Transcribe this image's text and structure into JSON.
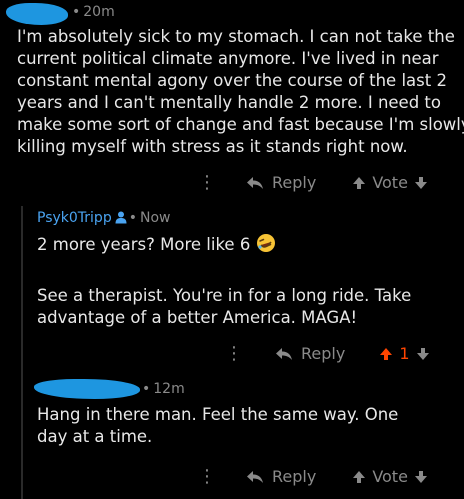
{
  "comments": [
    {
      "username": "",
      "time": "20m",
      "lines": [
        "I'm absolutely sick to my stomach. I can not take the",
        "current political climate anymore. I've lived in near",
        "constant mental agony over the course of the last 2",
        "years and I can't mentally handle 2 more. I need to",
        "make some sort of change and fast because I'm slowly",
        "killing myself with stress as it stands right now."
      ],
      "reply_label": "Reply",
      "vote_label": "Vote"
    },
    {
      "username": "Psyk0Tripp",
      "time": "Now",
      "lines": [
        "2 more years?  More like 6",
        "",
        "See a therapist. You're in for a long ride. Take",
        "advantage of a better America. MAGA!"
      ],
      "emoji": "rolling-on-floor-laughing",
      "reply_label": "Reply",
      "vote_count": "1",
      "upvote_color": "#ff4500"
    },
    {
      "username": "",
      "time": "12m",
      "lines": [
        "Hang in there man. Feel the same way. One",
        "day at a time."
      ],
      "reply_label": "Reply",
      "vote_label": "Vote"
    }
  ],
  "colors": {
    "background": "#000000",
    "text": "#e8e8e8",
    "meta": "#8a8a8a",
    "username": "#4aa3f0",
    "redaction": "#1e96e0"
  }
}
